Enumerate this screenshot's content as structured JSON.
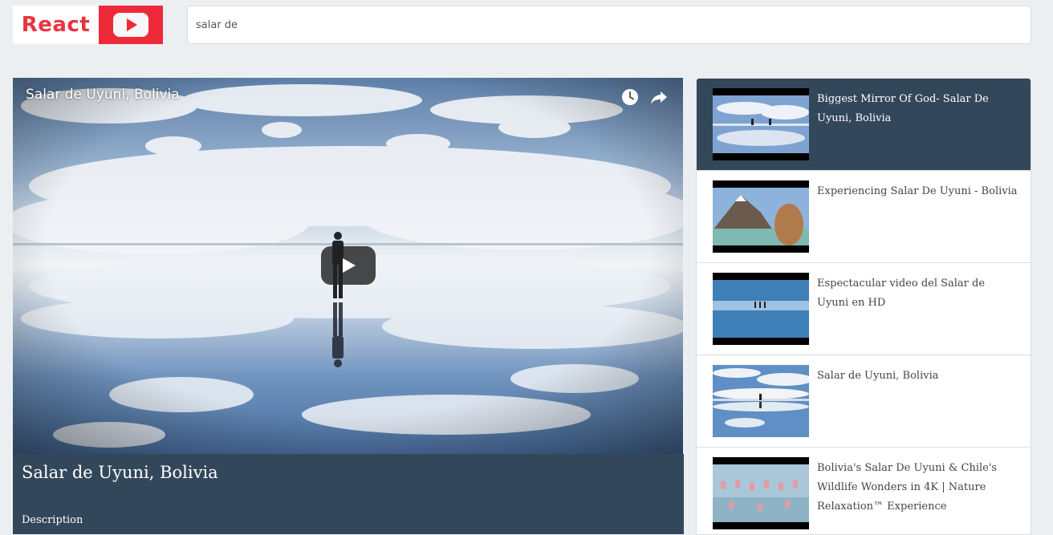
{
  "app": {
    "logo_text": "React"
  },
  "search": {
    "value": "salar de"
  },
  "player": {
    "overlay_title": "Salar de Uyuni, Bolivia"
  },
  "details": {
    "title": "Salar de Uyuni, Bolivia",
    "description_label": "Description"
  },
  "video_list": {
    "items": [
      {
        "title": "Biggest Mirror Of God- Salar De Uyuni, Bolivia",
        "selected": true
      },
      {
        "title": "Experiencing Salar De Uyuni - Bolivia",
        "selected": false
      },
      {
        "title": "Espectacular video del Salar de Uyuni en HD",
        "selected": false
      },
      {
        "title": "Salar de Uyuni, Bolivia",
        "selected": false
      },
      {
        "title": "Bolivia's Salar De Uyuni & Chile's Wildlife Wonders in 4K | Nature Relaxation™ Experience",
        "selected": false
      }
    ]
  },
  "colors": {
    "brand_red": "#ee2a3a",
    "panel_dark": "#33475b",
    "page_bg": "#eceff1"
  }
}
